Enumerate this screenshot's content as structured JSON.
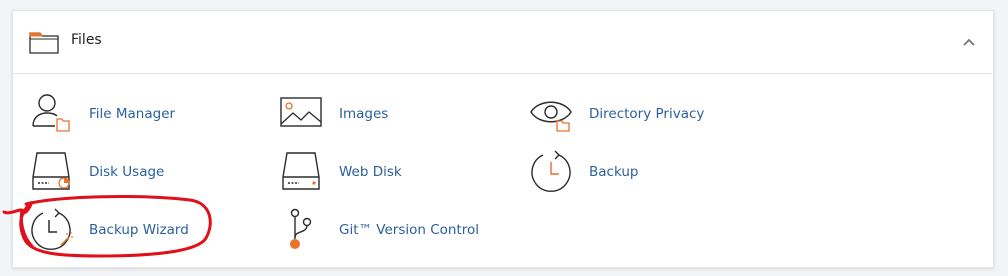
{
  "section": {
    "title": "Files",
    "icon": "folder-icon",
    "collapse_icon": "chevron-up-icon"
  },
  "items": [
    {
      "label": "File Manager",
      "icon": "file-manager-icon"
    },
    {
      "label": "Images",
      "icon": "images-icon"
    },
    {
      "label": "Directory Privacy",
      "icon": "eye-icon"
    },
    {
      "label": "Disk Usage",
      "icon": "disk-usage-icon"
    },
    {
      "label": "Web Disk",
      "icon": "web-disk-icon"
    },
    {
      "label": "Backup",
      "icon": "backup-clock-icon"
    },
    {
      "label": "Backup Wizard",
      "icon": "backup-wizard-icon"
    },
    {
      "label": "Git™ Version Control",
      "icon": "git-icon"
    }
  ],
  "colors": {
    "accent": "#e8742a",
    "link": "#2c5f9e",
    "icon_stroke": "#2b2b2b",
    "annotation": "#e0101a"
  }
}
